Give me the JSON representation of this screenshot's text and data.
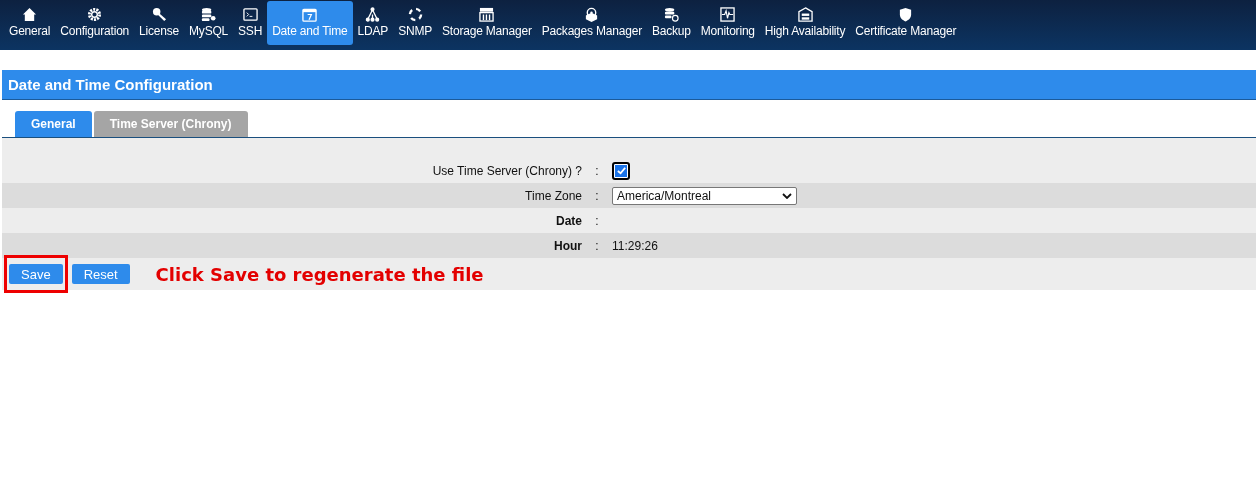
{
  "nav": [
    {
      "label": "General",
      "selected": false
    },
    {
      "label": "Configuration",
      "selected": false
    },
    {
      "label": "License",
      "selected": false
    },
    {
      "label": "MySQL",
      "selected": false
    },
    {
      "label": "SSH",
      "selected": false
    },
    {
      "label": "Date and Time",
      "selected": true
    },
    {
      "label": "LDAP",
      "selected": false
    },
    {
      "label": "SNMP",
      "selected": false
    },
    {
      "label": "Storage Manager",
      "selected": false
    },
    {
      "label": "Packages Manager",
      "selected": false
    },
    {
      "label": "Backup",
      "selected": false
    },
    {
      "label": "Monitoring",
      "selected": false
    },
    {
      "label": "High Availability",
      "selected": false
    },
    {
      "label": "Certificate Manager",
      "selected": false
    }
  ],
  "panel": {
    "title": "Date and Time Configuration"
  },
  "tabs": [
    {
      "label": "General",
      "selected": true
    },
    {
      "label": "Time Server (Chrony)",
      "selected": false
    }
  ],
  "form": [
    {
      "kind": "checkbox",
      "label": "Use Time Server (Chrony) ?",
      "separator": ":",
      "bold": false,
      "checked": true
    },
    {
      "kind": "select",
      "label": "Time Zone",
      "separator": ":",
      "bold": false,
      "value": "America/Montreal"
    },
    {
      "kind": "text",
      "label": "Date",
      "separator": ":",
      "bold": true
    },
    {
      "kind": "text",
      "label": "Hour",
      "separator": ":",
      "bold": true,
      "value": "11:29:26"
    }
  ],
  "buttons": [
    {
      "label": "Save",
      "highlighted": true
    },
    {
      "label": "Reset",
      "highlighted": false
    }
  ],
  "annotation": "Click Save to regenerate the file"
}
